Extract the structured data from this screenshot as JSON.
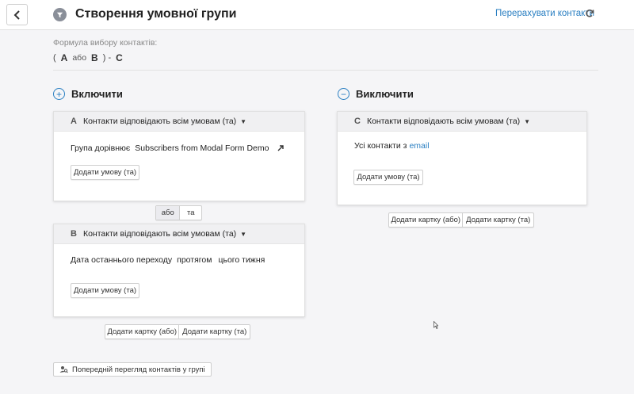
{
  "header": {
    "title": "Створення умовної групи",
    "recalc_label": "Перерахувати контакти"
  },
  "formula": {
    "label": "Формула вибору контактів:",
    "open": "(",
    "a": "A",
    "or": "або",
    "b": "B",
    "close_minus": ") -",
    "c": "C"
  },
  "include": {
    "title": "Включити",
    "card_a": {
      "letter": "A",
      "mode": "Контакти відповідають всім умовам (та)",
      "condition_text": "Група дорівнює",
      "condition_value": "Subscribers from Modal Form Demo",
      "add_condition": "Додати умову (та)"
    },
    "join": {
      "or": "або",
      "and": "та"
    },
    "card_b": {
      "letter": "B",
      "mode": "Контакти відповідають всім умовам (та)",
      "condition_text": "Дата останнього переходу",
      "condition_op": "протягом",
      "condition_value": "цього тижня",
      "add_condition": "Додати умову (та)"
    },
    "add_card_or": "Додати картку (або)",
    "add_card_and": "Додати картку (та)"
  },
  "exclude": {
    "title": "Виключити",
    "card_c": {
      "letter": "C",
      "mode": "Контакти відповідають всім умовам (та)",
      "condition_text": "Усі контакти з",
      "condition_value": "email",
      "add_condition": "Додати умову (та)"
    },
    "add_card_or": "Додати картку (або)",
    "add_card_and": "Додати картку (та)"
  },
  "preview_label": "Попередній перегляд контактів у групі",
  "colors": {
    "accent": "#2a7fc2",
    "background": "#f5f5f7",
    "card_head": "#f0f0f2"
  }
}
